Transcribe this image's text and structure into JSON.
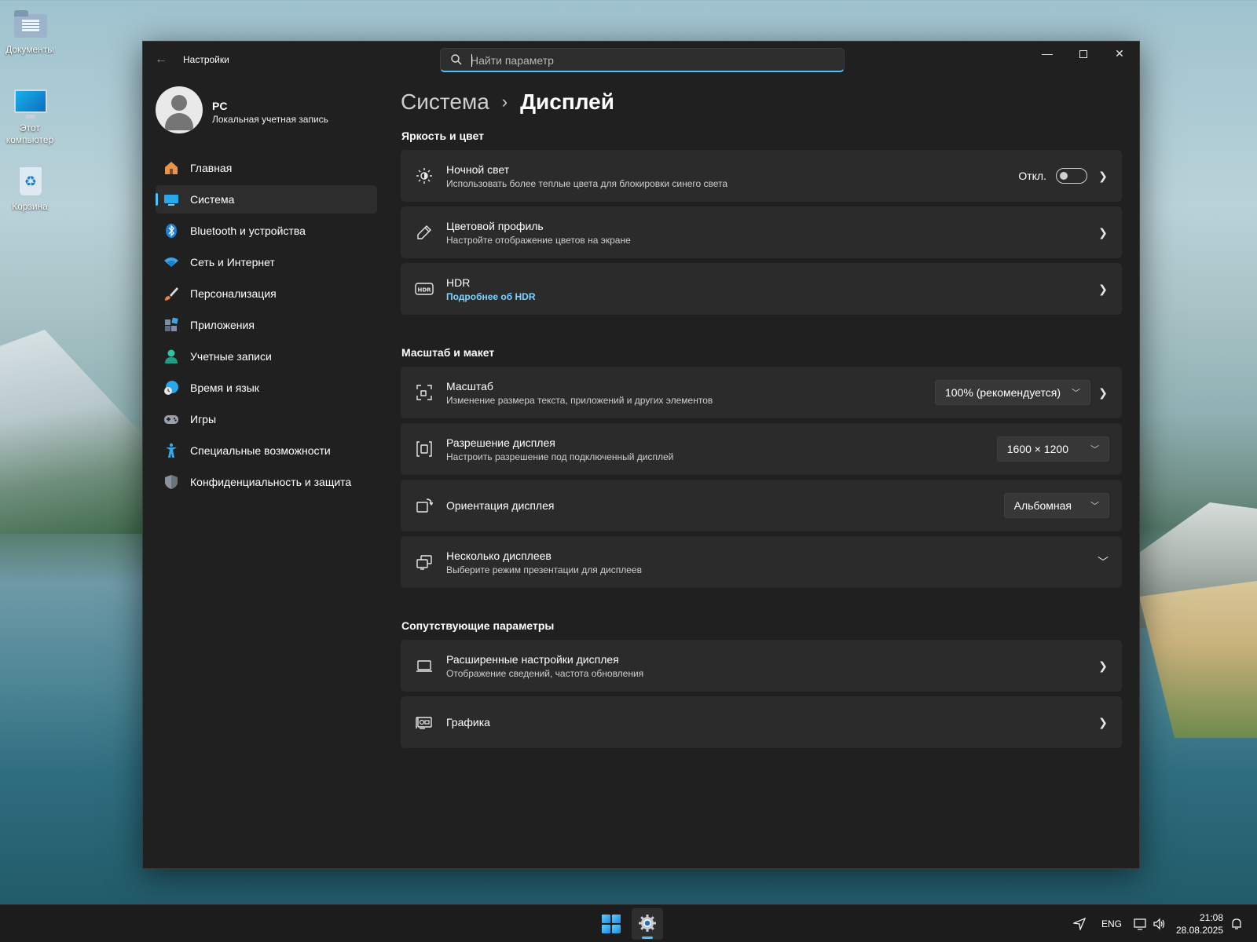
{
  "desktop": {
    "icons": [
      {
        "label": "Документы",
        "icon": "folder-icon"
      },
      {
        "label": "Этот компьютер",
        "icon": "computer-icon"
      },
      {
        "label": "Корзина",
        "icon": "recycle-bin-icon"
      }
    ]
  },
  "window": {
    "title": "Настройки",
    "search_placeholder": "Найти параметр",
    "controls": [
      "minimize",
      "maximize",
      "close"
    ]
  },
  "profile": {
    "name": "PC",
    "account_type": "Локальная учетная запись"
  },
  "sidebar": {
    "items": [
      {
        "label": "Главная",
        "icon": "home-icon",
        "active": false
      },
      {
        "label": "Система",
        "icon": "system-icon",
        "active": true
      },
      {
        "label": "Bluetooth и устройства",
        "icon": "bluetooth-icon",
        "active": false
      },
      {
        "label": "Сеть и Интернет",
        "icon": "wifi-icon",
        "active": false
      },
      {
        "label": "Персонализация",
        "icon": "brush-icon",
        "active": false
      },
      {
        "label": "Приложения",
        "icon": "apps-icon",
        "active": false
      },
      {
        "label": "Учетные записи",
        "icon": "accounts-icon",
        "active": false
      },
      {
        "label": "Время и язык",
        "icon": "time-language-icon",
        "active": false
      },
      {
        "label": "Игры",
        "icon": "gamepad-icon",
        "active": false
      },
      {
        "label": "Специальные возможности",
        "icon": "accessibility-icon",
        "active": false
      },
      {
        "label": "Конфиденциальность и защита",
        "icon": "shield-icon",
        "active": false
      }
    ]
  },
  "breadcrumb": {
    "parent": "Система",
    "separator": "›",
    "current": "Дисплей"
  },
  "sections": {
    "brightness": {
      "title": "Яркость и цвет",
      "night_light": {
        "title": "Ночной свет",
        "subtitle": "Использовать более теплые цвета для блокировки синего света",
        "state_label": "Откл.",
        "on": false
      },
      "color_profile": {
        "title": "Цветовой профиль",
        "subtitle": "Настройте отображение цветов на экране"
      },
      "hdr": {
        "title": "HDR",
        "link": "Подробнее об HDR"
      }
    },
    "scale_layout": {
      "title": "Масштаб и макет",
      "scale": {
        "title": "Масштаб",
        "subtitle": "Изменение размера текста, приложений и других элементов",
        "value": "100% (рекомендуется)"
      },
      "resolution": {
        "title": "Разрешение дисплея",
        "subtitle": "Настроить разрешение под подключенный дисплей",
        "value": "1600 × 1200"
      },
      "orientation": {
        "title": "Ориентация дисплея",
        "value": "Альбомная"
      },
      "multiple_displays": {
        "title": "Несколько дисплеев",
        "subtitle": "Выберите режим презентации для дисплеев"
      }
    },
    "related": {
      "title": "Сопутствующие параметры",
      "advanced_display": {
        "title": "Расширенные настройки дисплея",
        "subtitle": "Отображение сведений, частота обновления"
      },
      "graphics": {
        "title": "Графика"
      }
    }
  },
  "taskbar": {
    "language": "ENG",
    "time": "21:08",
    "date": "28.08.2025"
  },
  "colors": {
    "accent": "#4cc2ff",
    "window_bg": "#202020",
    "card_bg": "#2b2b2b",
    "link": "#7fd3ff"
  }
}
